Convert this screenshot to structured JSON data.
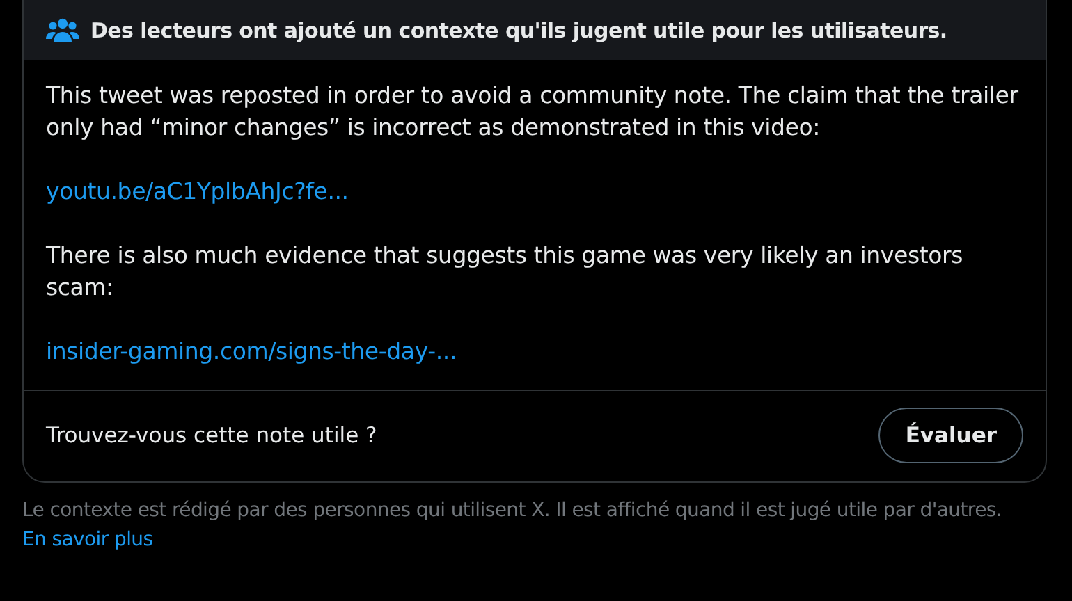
{
  "note": {
    "header": "Des lecteurs ont ajouté un contexte qu'ils jugent utile pour les utilisateurs.",
    "body": [
      {
        "kind": "text",
        "text": "This tweet was reposted in order to avoid a community note. The claim that the trailer only had “minor changes” is incorrect as demonstrated in this video:"
      },
      {
        "kind": "link",
        "text": "youtu.be/aC1YplbAhJc?fe..."
      },
      {
        "kind": "text",
        "text": "There is also much evidence that suggests this game was very likely an investors scam:"
      },
      {
        "kind": "link",
        "text": "insider-gaming.com/signs-the-day-..."
      }
    ],
    "question": "Trouvez-vous cette note utile ?",
    "rate_button": "Évaluer"
  },
  "footer": {
    "text": "Le contexte est rédigé par des personnes qui utilisent X. Il est affiché quand il est jugé utile par d'autres.",
    "link": "En savoir plus"
  }
}
